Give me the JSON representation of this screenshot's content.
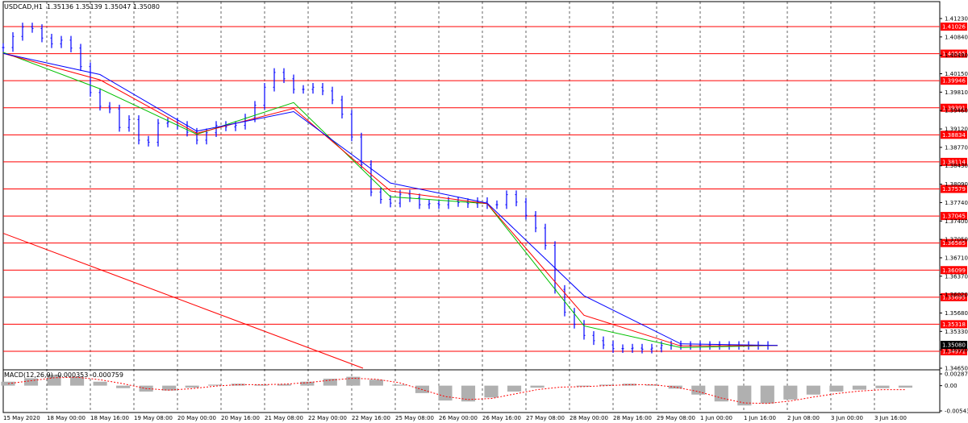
{
  "header": {
    "symbol_timeframe": "USDCAD,H1",
    "ohlc": "1.35136 1.35139 1.35047 1.35080"
  },
  "macd_header": "MACD(12,26,9) -0.000353 -0.000759",
  "colors": {
    "background": "#ffffff",
    "price_bars": "#0000ff",
    "level_lines": "#ff0000",
    "ma_fast": "#00c000",
    "ma_mid": "#ff0000",
    "ma_slow": "#0000ff",
    "macd_hist": "#b0b0b0",
    "macd_signal": "#ff0000",
    "grid": "#000000"
  },
  "chart_data": {
    "type": "line",
    "price_axis_ticks": [
      "1.41230",
      "1.40840",
      "1.40490",
      "1.40150",
      "1.39810",
      "1.39460",
      "1.39120",
      "1.38770",
      "1.38430",
      "1.38090",
      "1.37740",
      "1.37400",
      "1.37050",
      "1.36710",
      "1.36370",
      "1.36020",
      "1.35680",
      "1.35330",
      "1.34990",
      "1.34650"
    ],
    "price_range": [
      1.3465,
      1.4135
    ],
    "current_price": "1.35080",
    "support_resistance_levels": [
      "1.41026",
      "1.40565",
      "1.39946",
      "1.39391",
      "1.38834",
      "1.38114",
      "1.37579",
      "1.37045",
      "1.36585",
      "1.36099",
      "1.35695",
      "1.35318",
      "1.34971"
    ],
    "time_labels": [
      "15 May 2020",
      "18 May 00:00",
      "18 May 16:00",
      "19 May 08:00",
      "20 May 00:00",
      "20 May 16:00",
      "21 May 08:00",
      "22 May 00:00",
      "22 May 16:00",
      "25 May 08:00",
      "26 May 00:00",
      "26 May 16:00",
      "27 May 08:00",
      "28 May 00:00",
      "28 May 16:00",
      "29 May 08:00",
      "1 Jun 00:00",
      "1 Jun 16:00",
      "2 Jun 08:00",
      "3 Jun 00:00",
      "3 Jun 16:00"
    ],
    "series": [
      {
        "type": "bar",
        "color": "#0000ff",
        "x": [
          0,
          4,
          8,
          12,
          16,
          20,
          24,
          28,
          32,
          36,
          40,
          44,
          48,
          52,
          56,
          60,
          64,
          68,
          72,
          76,
          80,
          84,
          88,
          92,
          96,
          100,
          104,
          108,
          112,
          116,
          120,
          124,
          128,
          132,
          136,
          140,
          144,
          148,
          152,
          156,
          160,
          164,
          168,
          172,
          176,
          180,
          184,
          188,
          192,
          196,
          200,
          204,
          208,
          212,
          216,
          220,
          224,
          228,
          232,
          236,
          240,
          244,
          248,
          252,
          256,
          260,
          264,
          268,
          272,
          276,
          280,
          284,
          288,
          292,
          296,
          300,
          304,
          308,
          312,
          316
        ],
        "values": [
          1.4071,
          1.4092,
          1.411,
          1.4107,
          1.4089,
          1.4078,
          1.4085,
          1.407,
          1.4035,
          1.3986,
          1.396,
          1.3955,
          1.392,
          1.3935,
          1.3896,
          1.3892,
          1.3928,
          1.393,
          1.3924,
          1.3911,
          1.3896,
          1.391,
          1.3924,
          1.3921,
          1.3924,
          1.3938,
          1.3962,
          1.3996,
          1.4024,
          1.4012,
          1.3992,
          1.3992,
          1.3996,
          1.3989,
          1.3972,
          1.3945,
          1.3902,
          1.385,
          1.3798,
          1.3784,
          1.3777,
          1.3794,
          1.3787,
          1.3774,
          1.3776,
          1.3774,
          1.3781,
          1.3778,
          1.3776,
          1.378,
          1.3774,
          1.3774,
          1.3793,
          1.3779,
          1.3754,
          1.373,
          1.3697,
          1.3614,
          1.3571,
          1.3548,
          1.3527,
          1.3517,
          1.3509,
          1.3502,
          1.3502,
          1.3503,
          1.3501,
          1.3503,
          1.3508,
          1.3509,
          1.3508,
          1.3508,
          1.3508,
          1.3508,
          1.3508,
          1.3508,
          1.3508,
          1.3508,
          1.3508,
          1.3508
        ]
      },
      {
        "name": "MA fast",
        "color": "#00c000",
        "x": [
          0,
          40,
          80,
          120,
          160,
          200,
          240,
          280,
          320
        ],
        "values": [
          1.4062,
          1.3993,
          1.3907,
          1.3967,
          1.3789,
          1.3776,
          1.3545,
          1.3504,
          1.3508
        ]
      },
      {
        "name": "MA mid",
        "color": "#ff0000",
        "x": [
          0,
          40,
          80,
          120,
          160,
          200,
          240,
          280,
          320
        ],
        "values": [
          1.406,
          1.401,
          1.3909,
          1.3956,
          1.38,
          1.3776,
          1.3565,
          1.3507,
          1.3508
        ]
      },
      {
        "name": "MA slow",
        "color": "#0000ff",
        "x": [
          0,
          40,
          80,
          120,
          160,
          200,
          240,
          280,
          320
        ],
        "values": [
          1.406,
          1.402,
          1.3913,
          1.395,
          1.3815,
          1.3777,
          1.3602,
          1.3511,
          1.3508
        ]
      }
    ],
    "macd": {
      "axis_ticks": [
        "0.002876",
        "0.00",
        "-0.005433"
      ],
      "range": [
        -0.005433,
        0.002876
      ],
      "histogram": [
        0.0008,
        0.0015,
        0.0022,
        0.0018,
        0.0008,
        -0.0005,
        -0.0012,
        -0.001,
        -0.0004,
        0.0002,
        0.0004,
        0.0002,
        0.0003,
        0.0008,
        0.0014,
        0.0018,
        0.0012,
        0.0002,
        -0.0015,
        -0.003,
        -0.0032,
        -0.0024,
        -0.0012,
        -0.0004,
        0.0,
        -0.0002,
        0.0002,
        0.0004,
        0.0002,
        -0.0006,
        -0.0018,
        -0.0032,
        -0.004,
        -0.0036,
        -0.0028,
        -0.0018,
        -0.0012,
        -0.0008,
        -0.0005,
        -0.0004
      ],
      "signal": [
        0.0004,
        0.001,
        0.0016,
        0.0017,
        0.0012,
        0.0004,
        -0.0006,
        -0.0009,
        -0.0006,
        -0.0001,
        0.0002,
        0.0002,
        0.0003,
        0.0006,
        0.0011,
        0.0015,
        0.0013,
        0.0006,
        -0.0008,
        -0.0022,
        -0.0028,
        -0.0026,
        -0.0017,
        -0.0008,
        -0.0003,
        -0.0002,
        0.0,
        0.0002,
        0.0002,
        -0.0003,
        -0.0012,
        -0.0025,
        -0.0035,
        -0.0036,
        -0.0031,
        -0.0023,
        -0.0016,
        -0.0011,
        -0.0008,
        -0.0008
      ]
    },
    "trendline": {
      "color": "#ff0000",
      "from": {
        "time": "15 May 2020",
        "price": 1.372
      },
      "to": {
        "time": "26 May 16:00",
        "price": 1.3465
      }
    }
  }
}
